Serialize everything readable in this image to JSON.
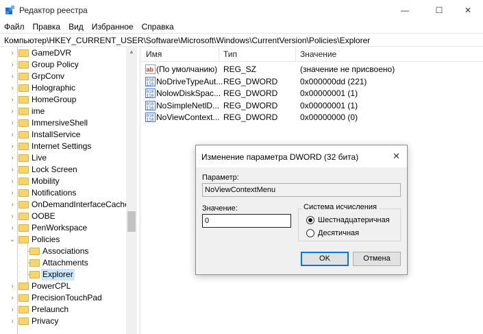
{
  "window": {
    "title": "Редактор реестра",
    "min_glyph": "—",
    "max_glyph": "☐",
    "close_glyph": "✕"
  },
  "menu": [
    "Файл",
    "Правка",
    "Вид",
    "Избранное",
    "Справка"
  ],
  "address": "Компьютер\\HKEY_CURRENT_USER\\Software\\Microsoft\\Windows\\CurrentVersion\\Policies\\Explorer",
  "tree": {
    "items": [
      {
        "label": "GameDVR",
        "expander": "›"
      },
      {
        "label": "Group Policy",
        "expander": "›"
      },
      {
        "label": "GrpConv",
        "expander": "›"
      },
      {
        "label": "Holographic",
        "expander": "›"
      },
      {
        "label": "HomeGroup",
        "expander": "›"
      },
      {
        "label": "ime",
        "expander": "›"
      },
      {
        "label": "ImmersiveShell",
        "expander": "›"
      },
      {
        "label": "InstallService",
        "expander": "›"
      },
      {
        "label": "Internet Settings",
        "expander": "›"
      },
      {
        "label": "Live",
        "expander": "›"
      },
      {
        "label": "Lock Screen",
        "expander": "›"
      },
      {
        "label": "Mobility",
        "expander": "›"
      },
      {
        "label": "Notifications",
        "expander": "›"
      },
      {
        "label": "OnDemandInterfaceCache",
        "expander": "›"
      },
      {
        "label": "OOBE",
        "expander": "›"
      },
      {
        "label": "PenWorkspace",
        "expander": "›"
      },
      {
        "label": "Policies",
        "expander": "⌄"
      },
      {
        "label": "Associations",
        "expander": ""
      },
      {
        "label": "Attachments",
        "expander": ""
      },
      {
        "label": "Explorer",
        "expander": "",
        "selected": true
      },
      {
        "label": "PowerCPL",
        "expander": "›"
      },
      {
        "label": "PrecisionTouchPad",
        "expander": "›"
      },
      {
        "label": "Prelaunch",
        "expander": "›"
      },
      {
        "label": "Privacy",
        "expander": "›"
      }
    ]
  },
  "list": {
    "headers": {
      "name": "Имя",
      "type": "Тип",
      "value": "Значение"
    },
    "rows": [
      {
        "name": "(По умолчанию)",
        "type": "REG_SZ",
        "value": "(значение не присвоено)",
        "icon": "string-value-icon"
      },
      {
        "name": "NoDriveTypeAut...",
        "type": "REG_DWORD",
        "value": "0x000000dd (221)",
        "icon": "binary-value-icon"
      },
      {
        "name": "NolowDiskSpac...",
        "type": "REG_DWORD",
        "value": "0x00000001 (1)",
        "icon": "binary-value-icon"
      },
      {
        "name": "NoSimpleNetlD...",
        "type": "REG_DWORD",
        "value": "0x00000001 (1)",
        "icon": "binary-value-icon"
      },
      {
        "name": "NoViewContext...",
        "type": "REG_DWORD",
        "value": "0x00000000 (0)",
        "icon": "binary-value-icon"
      }
    ]
  },
  "dialog": {
    "title": "Изменение параметра DWORD (32 бита)",
    "close_glyph": "✕",
    "param_label": "Параметр:",
    "param_value": "NoViewContextMenu",
    "value_label": "Значение:",
    "value": "0",
    "base_label": "Система исчисления",
    "radio_hex": "Шестнадцатеричная",
    "radio_dec": "Десятичная",
    "selected_base": "hex",
    "ok": "OK",
    "cancel": "Отмена"
  },
  "colors": {
    "selection": "#cce8ff",
    "folder": "#f7d56b",
    "default_button_border": "#0078d7"
  }
}
